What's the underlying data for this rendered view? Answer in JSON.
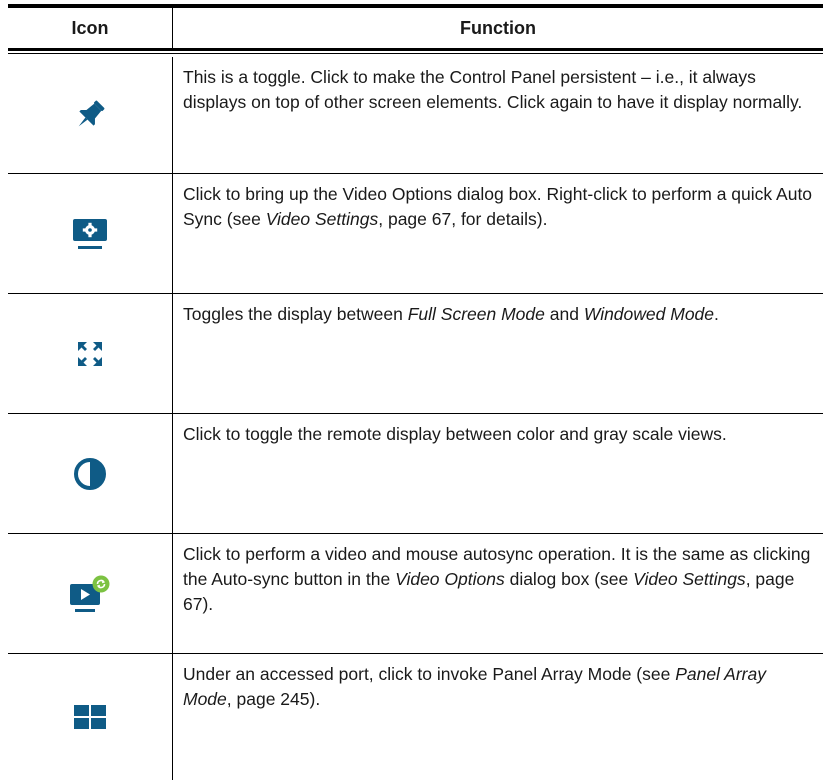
{
  "header": {
    "icon_col": "Icon",
    "function_col": "Function"
  },
  "colors": {
    "icon": "#0f5b86",
    "sync_badge": "#7cc242"
  },
  "rows": [
    {
      "icon": "pin-icon",
      "text": "This is a toggle. Click to make the Control Panel persistent – i.e., it always displays on top of other screen elements. Click again to have it display normally."
    },
    {
      "icon": "video-settings-icon",
      "t1": "Click to bring up the Video Options dialog box. Right-click to perform a quick Auto Sync (see ",
      "i1": "Video Settings",
      "t2": ", page 67, for details)."
    },
    {
      "icon": "fullscreen-icon",
      "t1": "Toggles the display between ",
      "i1": "Full Screen Mode",
      "t2": " and ",
      "i2": "Windowed Mode",
      "t3": "."
    },
    {
      "icon": "contrast-icon",
      "text": "Click to toggle the remote display between color and gray scale views."
    },
    {
      "icon": "autosync-icon",
      "t1": "Click to perform a video and mouse autosync operation. It is the same as clicking the Auto-sync button in the ",
      "i1": "Video Options",
      "t2": " dialog box (see ",
      "i2": "Video Settings",
      "t3": ", page 67)."
    },
    {
      "icon": "panel-array-icon",
      "t1": "Under an accessed port, click to invoke Panel Array Mode (see ",
      "i1": "Panel Array Mode",
      "t2": ", page 245)."
    }
  ]
}
